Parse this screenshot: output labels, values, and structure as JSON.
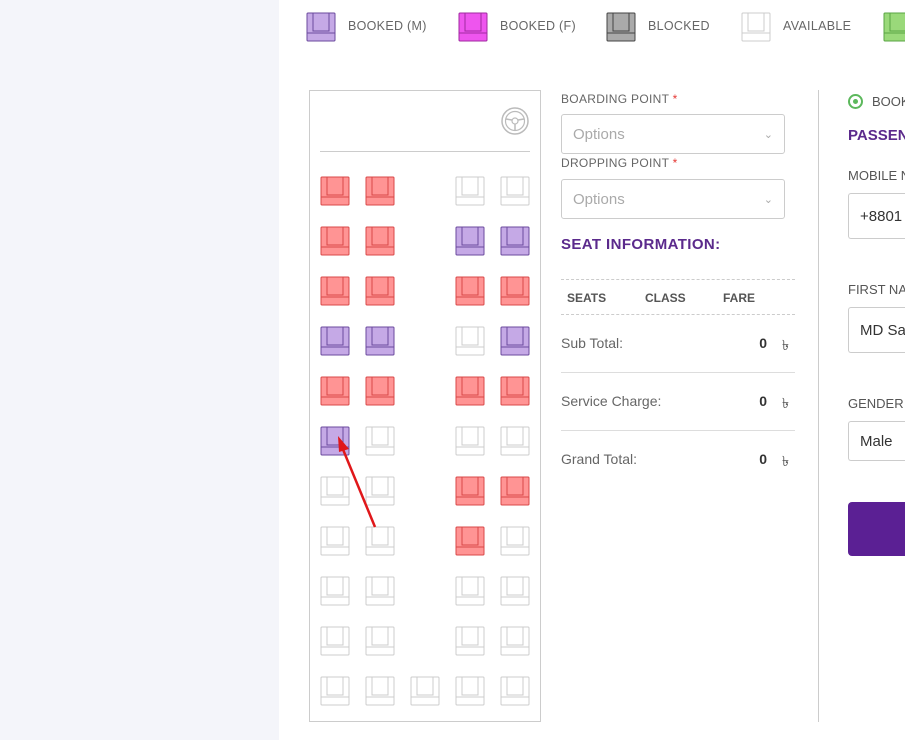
{
  "legend": [
    {
      "label": "BOOKED (M)",
      "type": "male"
    },
    {
      "label": "BOOKED (F)",
      "type": "female"
    },
    {
      "label": "BLOCKED",
      "type": "blocked"
    },
    {
      "label": "AVAILABLE",
      "type": "available"
    },
    {
      "label": "",
      "type": "selected"
    }
  ],
  "colors": {
    "male": "#c5a9e6",
    "male_stroke": "#6b4a9e",
    "female": "#ee55ee",
    "female_stroke": "#a02aa0",
    "blocked": "#aaaaaa",
    "blocked_stroke": "#444444",
    "available": "#ffffff",
    "available_stroke": "#cccccc",
    "sold": "#ff9494",
    "sold_stroke": "#d94848",
    "selected": "#9ad97a",
    "selected_stroke": "#5aa544",
    "accent": "#5b2a8c",
    "arrow": "#e0171a"
  },
  "seat_rows": [
    [
      "sold",
      "sold",
      null,
      "available",
      "available"
    ],
    [
      "sold",
      "sold",
      null,
      "male",
      "male"
    ],
    [
      "sold",
      "sold",
      null,
      "sold",
      "sold"
    ],
    [
      "male",
      "male",
      null,
      "available",
      "male"
    ],
    [
      "sold",
      "sold",
      null,
      "sold",
      "sold"
    ],
    [
      "male",
      "available",
      null,
      "available",
      "available"
    ],
    [
      "available",
      "available",
      null,
      "sold",
      "sold"
    ],
    [
      "available",
      "available",
      null,
      "sold",
      "available"
    ],
    [
      "available",
      "available",
      null,
      "available",
      "available"
    ],
    [
      "available",
      "available",
      null,
      "available",
      "available"
    ],
    [
      "available",
      "available",
      "available",
      "available",
      "available"
    ]
  ],
  "boarding": {
    "label": "BOARDING POINT",
    "required": "*",
    "placeholder": "Options"
  },
  "dropping": {
    "label": "DROPPING POINT",
    "required": "*",
    "placeholder": "Options"
  },
  "seat_info": {
    "title": "SEAT INFORMATION:",
    "headers": [
      "SEATS",
      "CLASS",
      "FARE"
    ],
    "rows": [
      {
        "label": "Sub Total:",
        "value": "0",
        "currency": "৳"
      },
      {
        "label": "Service Charge:",
        "value": "0",
        "currency": "৳"
      },
      {
        "label": "Grand Total:",
        "value": "0",
        "currency": "৳"
      }
    ]
  },
  "right": {
    "radio_label": "BOOK",
    "passenger_title": "PASSENG",
    "mobile_label": "MOBILE N",
    "mobile_value": "+8801",
    "first_name_label": "FIRST NA",
    "first_name_value": "MD Sa",
    "gender_label": "GENDER",
    "gender_value": "Male"
  }
}
